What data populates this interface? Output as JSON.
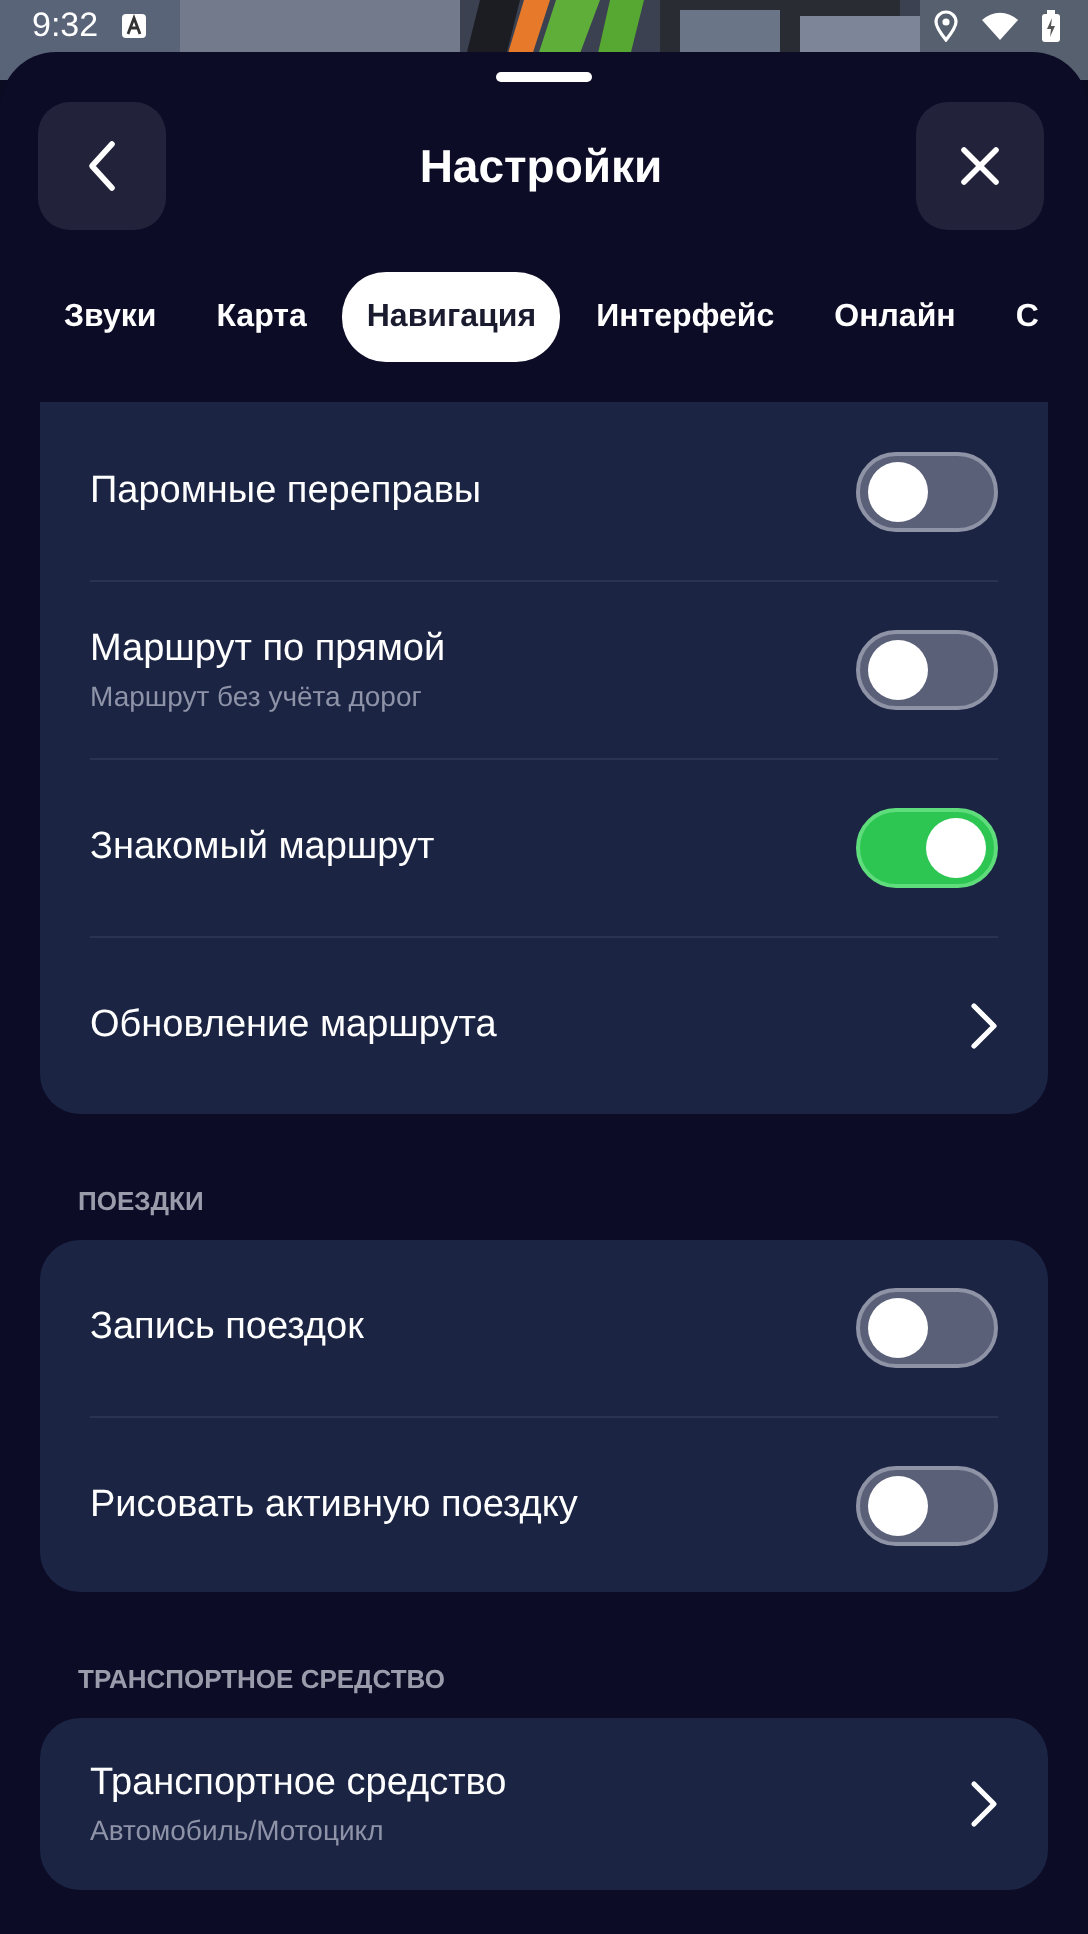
{
  "status_bar": {
    "time": "9:32"
  },
  "header": {
    "title": "Настройки"
  },
  "tabs": [
    {
      "label": "Звуки",
      "selected": false
    },
    {
      "label": "Карта",
      "selected": false
    },
    {
      "label": "Навигация",
      "selected": true
    },
    {
      "label": "Интерфейс",
      "selected": false
    },
    {
      "label": "Онлайн",
      "selected": false
    },
    {
      "label": "С",
      "selected": false
    }
  ],
  "sections": [
    {
      "rows": [
        {
          "kind": "toggle",
          "label": "Паромные переправы",
          "on": false
        },
        {
          "kind": "toggle",
          "label": "Маршрут по прямой",
          "subtitle": "Маршрут без учёта дорог",
          "on": false
        },
        {
          "kind": "toggle",
          "label": "Знакомый маршрут",
          "on": true
        },
        {
          "kind": "link",
          "label": "Обновление маршрута"
        }
      ]
    },
    {
      "header": "ПОЕЗДКИ",
      "rows": [
        {
          "kind": "toggle",
          "label": "Запись поездок",
          "on": false
        },
        {
          "kind": "toggle",
          "label": "Рисовать активную поездку",
          "on": false
        }
      ]
    },
    {
      "header": "ТРАНСПОРТНОЕ СРЕДСТВО",
      "rows": [
        {
          "kind": "link",
          "label": "Транспортное средство",
          "subtitle": "Автомобиль/Мотоцикл"
        }
      ]
    }
  ]
}
